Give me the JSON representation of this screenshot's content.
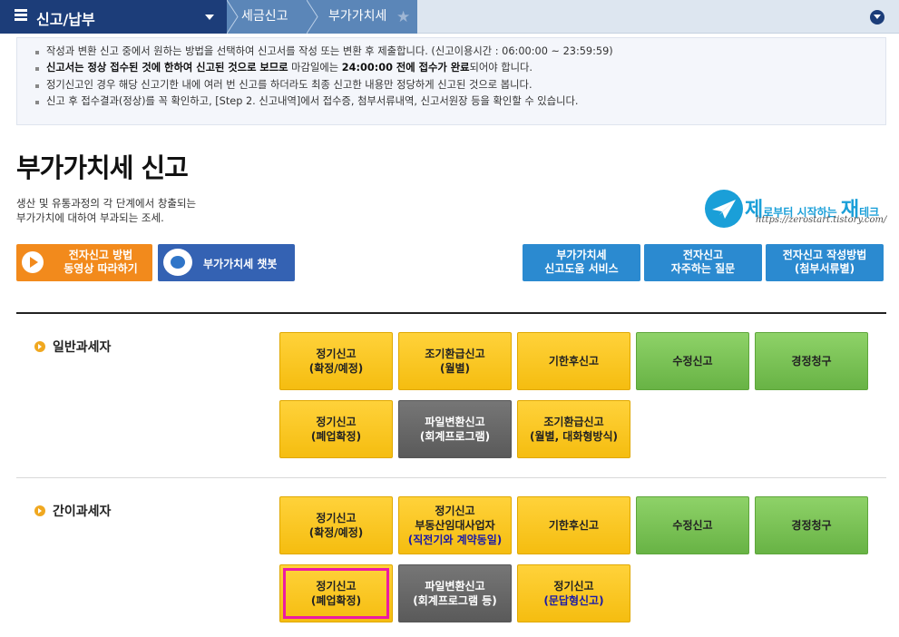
{
  "topnav": {
    "menu_title": "신고/납부",
    "breadcrumb": [
      "세금신고",
      "부가가치세"
    ]
  },
  "notice": {
    "items": [
      {
        "plain": "작성과 변환 신고 중에서 원하는 방법을 선택하여 신고서를 작성 또는 변환 후 제출합니다. (신고이용시간 : 06:00:00 ~ 23:59:59)"
      },
      {
        "bold_a": "신고서는 정상 접수된 것에 한하여 신고된 것으로 보므로",
        "mid": " 마감일에는 ",
        "bold_b": "24:00:00 전에 접수가 완료",
        "tail": "되어야 합니다."
      },
      {
        "plain": "정기신고인 경우 해당 신고기한 내에 여러 번 신고를 하더라도 최종 신고한 내용만 정당하게 신고된 것으로 봅니다."
      },
      {
        "plain": "신고 후 접수결과(정상)를 꼭 확인하고, [Step 2. 신고내역]에서 접수증, 첨부서류내역, 신고서원장 등을 확인할 수 있습니다."
      }
    ]
  },
  "page": {
    "title": "부가가치세 신고",
    "desc_line1": "생산 및 유통과정의 각 단계에서 창출되는",
    "desc_line2": "부가가치에 대하여 부과되는 조세."
  },
  "logo": {
    "small_a": "제",
    "small_b": "로부터 시작하는 ",
    "big": "재",
    "small_c": "테크",
    "url": "https://zerostart.tistory.com/"
  },
  "buttons": {
    "video_l1": "전자신고 방법",
    "video_l2": "동영상 따라하기",
    "chatbot": "부가가치세 챗봇",
    "help_l1": "부가가치세",
    "help_l2": "신고도움 서비스",
    "faq_l1": "전자신고",
    "faq_l2": "자주하는 질문",
    "guide_l1": "전자신고 작성방법",
    "guide_l2": "(첨부서류별)"
  },
  "general": {
    "label": "일반과세자",
    "t1_l1": "정기신고",
    "t1_l2": "(확정/예정)",
    "t2_l1": "조기환급신고",
    "t2_l2": "(월별)",
    "t3": "기한후신고",
    "t4": "수정신고",
    "t5": "경정청구",
    "t6_l1": "정기신고",
    "t6_l2": "(폐업확정)",
    "t7_l1": "파일변환신고",
    "t7_l2": "(회계프로그램)",
    "t8_l1": "조기환급신고",
    "t8_l2": "(월별, 대화형방식)"
  },
  "simple": {
    "label": "간이과세자",
    "t1_l1": "정기신고",
    "t1_l2": "(확정/예정)",
    "t2_l1": "정기신고",
    "t2_l2": "부동산임대사업자",
    "t2_l3": "(직전기와 계약동일)",
    "t3": "기한후신고",
    "t4": "수정신고",
    "t5": "경정청구",
    "t6_l1": "정기신고",
    "t6_l2": "(폐업확정)",
    "t7_l1": "파일변환신고",
    "t7_l2": "(회계프로그램 등)",
    "t8_l1": "정기신고",
    "t8_l2": "(문답형신고)"
  },
  "colors": {
    "nav_dark": "#1c3d79",
    "tile_yellow": "#f7c51b",
    "tile_green": "#79c355",
    "tile_gray": "#666666",
    "highlight": "#ec1ba3"
  }
}
